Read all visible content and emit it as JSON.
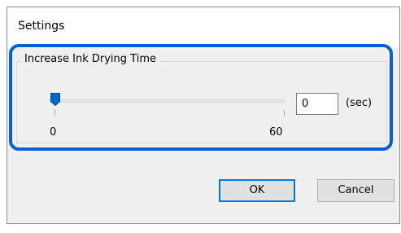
{
  "window": {
    "title": "Settings"
  },
  "group": {
    "label": "Increase Ink Drying Time"
  },
  "slider": {
    "min_label": "0",
    "max_label": "60",
    "value": 0,
    "min": 0,
    "max": 60
  },
  "value_field": {
    "value": "0",
    "unit": "(sec)"
  },
  "buttons": {
    "ok_label": "OK",
    "cancel_label": "Cancel"
  },
  "colors": {
    "highlight": "#0b5fd6",
    "thumb": "#0066cc",
    "default_button_border": "#0078d7"
  }
}
